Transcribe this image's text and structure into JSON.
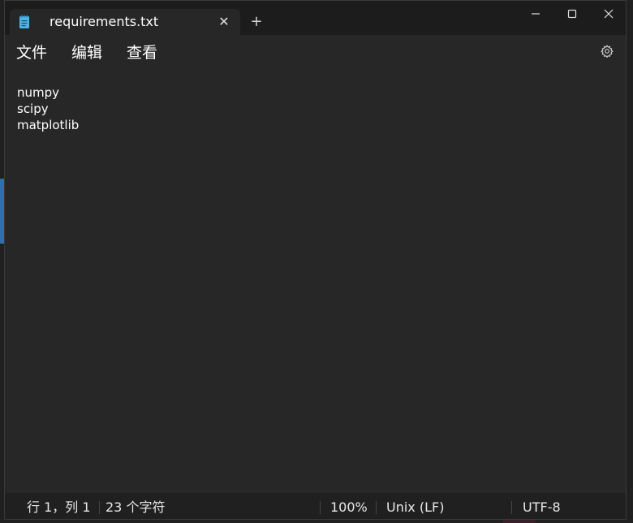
{
  "window": {
    "tab_title": "requirements.txt",
    "tab_close_glyph": "✕",
    "new_tab_glyph": "+"
  },
  "menu": {
    "items": [
      "文件",
      "编辑",
      "查看"
    ]
  },
  "editor": {
    "lines": [
      "numpy",
      "scipy",
      "matplotlib"
    ]
  },
  "status": {
    "position": "行 1，列 1",
    "char_count": "23 个字符",
    "zoom": "100%",
    "line_ending": "Unix (LF)",
    "encoding": "UTF-8"
  },
  "icons": {
    "app": "notepad-icon",
    "minimize": "minimize-icon",
    "maximize": "maximize-icon",
    "close": "close-icon",
    "settings": "gear-icon"
  },
  "colors": {
    "accent_icon": "#4fb3e8",
    "window_bg": "#272727",
    "titlebar_bg": "#1c1c1c",
    "text": "#ffffff"
  }
}
